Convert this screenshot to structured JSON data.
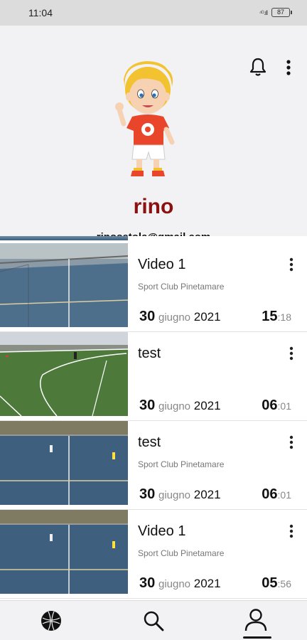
{
  "status_bar": {
    "time": "11:04",
    "battery": "87",
    "signal": "⁴ᴳ.ıll"
  },
  "profile": {
    "username": "rino",
    "email": "rinosetola@gmail.com"
  },
  "videos": [
    {
      "title": "Video 1",
      "club": "Sport Club Pinetamare",
      "day": "30",
      "month": "giugno",
      "year": "2021",
      "hour": "15",
      "minute": "18"
    },
    {
      "title": "test",
      "club": "",
      "day": "30",
      "month": "giugno",
      "year": "2021",
      "hour": "06",
      "minute": "01"
    },
    {
      "title": "test",
      "club": "Sport Club Pinetamare",
      "day": "30",
      "month": "giugno",
      "year": "2021",
      "hour": "06",
      "minute": "01"
    },
    {
      "title": "Video 1",
      "club": "Sport Club Pinetamare",
      "day": "30",
      "month": "giugno",
      "year": "2021",
      "hour": "05",
      "minute": "56"
    }
  ],
  "colors": {
    "username": "#8b1010",
    "background": "#f2f2f4",
    "court_blue": "#3d5c78",
    "turf_green": "#4d7a3a"
  },
  "icons": {
    "bell": "bell-icon",
    "more": "more-vertical-icon",
    "nav_home": "ball-icon",
    "nav_search": "search-icon",
    "nav_profile": "user-icon"
  }
}
